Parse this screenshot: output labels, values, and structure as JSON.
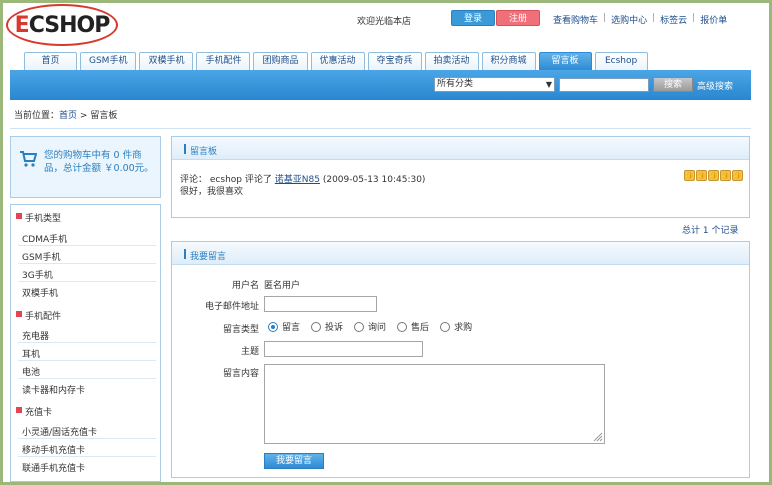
{
  "header": {
    "logo_text_accent": "E",
    "logo_text_rest": "CSHOP",
    "welcome": "欢迎光临本店",
    "login_label": "登录",
    "register_label": "注册",
    "top_links": [
      "查看购物车",
      "选购中心",
      "标签云",
      "报价单"
    ]
  },
  "nav": {
    "tabs": [
      "首页",
      "GSM手机",
      "双模手机",
      "手机配件",
      "团购商品",
      "优惠活动",
      "夺宝奇兵",
      "拍卖活动",
      "积分商城",
      "留言板",
      "Ecshop"
    ],
    "active_index": 9
  },
  "search": {
    "category_selected": "所有分类",
    "input_value": "",
    "button_label": "搜索",
    "advanced_label": "高级搜索"
  },
  "breadcrumb": {
    "prefix": "当前位置：",
    "home": "首页",
    "separator": ">",
    "current": "留言板"
  },
  "cart": {
    "text": "您的购物车中有 0 件商品，总计金额 ￥0.00元。"
  },
  "sidebar": {
    "groups": [
      {
        "title": "手机类型",
        "items": [
          "CDMA手机",
          "GSM手机",
          "3G手机",
          "双模手机"
        ]
      },
      {
        "title": "手机配件",
        "items": [
          "充电器",
          "耳机",
          "电池",
          "读卡器和内存卡"
        ]
      },
      {
        "title": "充值卡",
        "items": [
          "小灵通/固话充值卡",
          "移动手机充值卡",
          "联通手机充值卡"
        ]
      }
    ]
  },
  "board": {
    "title": "留言板",
    "message": {
      "type": "评论",
      "author": "ecshop",
      "verb": "评论了",
      "product": "诺基亚N85",
      "time": "(2009-05-13 10:45:30)",
      "content": "很好，我很喜欢"
    },
    "rating_stars": 5,
    "total_text": "总计 1 个记录"
  },
  "form": {
    "title": "我要留言",
    "user_label": "用户名",
    "user_value": "匿名用户",
    "email_label": "电子邮件地址",
    "email_value": "",
    "type_label": "留言类型",
    "type_options": [
      "留言",
      "投诉",
      "询问",
      "售后",
      "求购"
    ],
    "type_selected": 0,
    "subject_label": "主题",
    "subject_value": "",
    "content_label": "留言内容",
    "content_value": "",
    "submit_label": "我要留言"
  },
  "colors": {
    "accent_blue": "#2e8bd3",
    "logo_red": "#d8392e",
    "register_pink": "#f0707a",
    "frame_green": "#9cb77a"
  }
}
